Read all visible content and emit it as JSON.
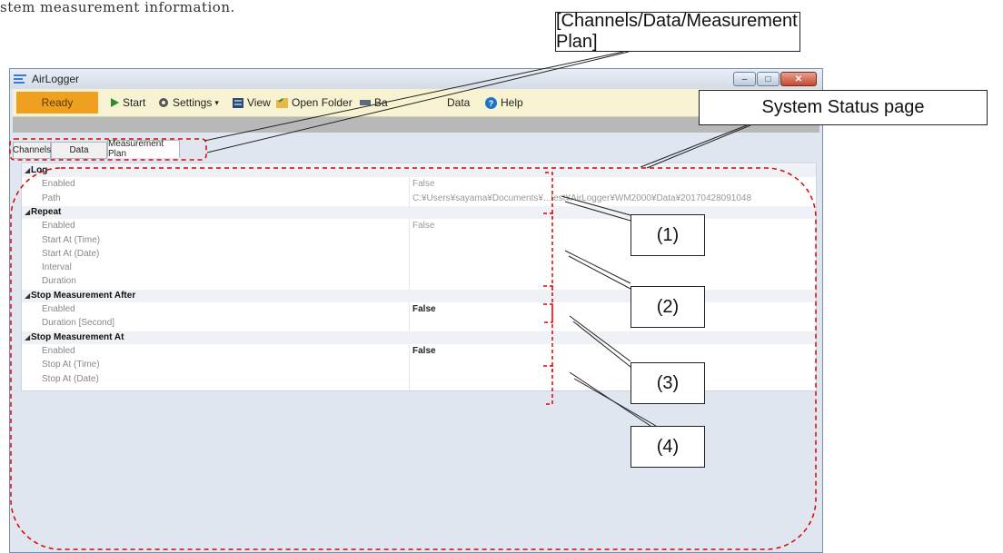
{
  "doc_text": "stem measurement information.",
  "window": {
    "title": "AirLogger",
    "controls": [
      "–",
      "□",
      "✕"
    ]
  },
  "toolbar": {
    "status": "Ready",
    "start": "Start",
    "settings": "Settings",
    "view": "View",
    "open_folder": "Open Folder",
    "back": "Ba",
    "data": "Data",
    "help": "Help"
  },
  "tabs": [
    "Channels",
    "Data",
    "Measurement Plan"
  ],
  "grid": {
    "rows": [
      {
        "type": "category",
        "label": "Log"
      },
      {
        "type": "prop",
        "label": "Enabled",
        "value": "False"
      },
      {
        "type": "prop",
        "label": "Path",
        "value": "C:¥Users¥sayama¥Documents¥...test¥AirLogger¥WM2000¥Data¥20170428091048"
      },
      {
        "type": "category",
        "label": "Repeat"
      },
      {
        "type": "prop",
        "label": "Enabled",
        "value": "False"
      },
      {
        "type": "prop",
        "label": "Start At (Time)",
        "value": ""
      },
      {
        "type": "prop",
        "label": "Start At (Date)",
        "value": ""
      },
      {
        "type": "prop",
        "label": "Interval",
        "value": ""
      },
      {
        "type": "prop",
        "label": "Duration",
        "value": ""
      },
      {
        "type": "category",
        "label": "Stop Measurement After"
      },
      {
        "type": "prop",
        "label": "Enabled",
        "value": "False",
        "dark": true
      },
      {
        "type": "prop",
        "label": "Duration [Second]",
        "value": ""
      },
      {
        "type": "category",
        "label": "Stop Measurement At"
      },
      {
        "type": "prop",
        "label": "Enabled",
        "value": "False",
        "dark": true
      },
      {
        "type": "prop",
        "label": "Stop At (Time)",
        "value": ""
      },
      {
        "type": "prop",
        "label": "Stop At (Date)",
        "value": ""
      }
    ]
  },
  "callouts": {
    "tabs_label": "[Channels/Data/Measurement Plan]",
    "status_label": "System Status page",
    "c1": "(1)",
    "c2": "(2)",
    "c3": "(3)",
    "c4": "(4)"
  },
  "colors": {
    "accent": "#f0a020",
    "annotation": "#e00000"
  }
}
